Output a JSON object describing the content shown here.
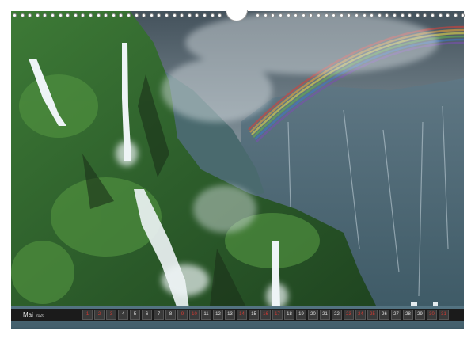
{
  "calendar": {
    "month": "Mai",
    "year": "2026",
    "days": [
      {
        "n": "1",
        "red": true
      },
      {
        "n": "2",
        "red": true
      },
      {
        "n": "3",
        "red": true
      },
      {
        "n": "4",
        "red": false
      },
      {
        "n": "5",
        "red": false
      },
      {
        "n": "6",
        "red": false
      },
      {
        "n": "7",
        "red": false
      },
      {
        "n": "8",
        "red": false
      },
      {
        "n": "9",
        "red": true
      },
      {
        "n": "10",
        "red": true
      },
      {
        "n": "11",
        "red": false
      },
      {
        "n": "12",
        "red": false
      },
      {
        "n": "13",
        "red": false
      },
      {
        "n": "14",
        "red": true
      },
      {
        "n": "15",
        "red": false
      },
      {
        "n": "16",
        "red": true
      },
      {
        "n": "17",
        "red": true
      },
      {
        "n": "18",
        "red": false
      },
      {
        "n": "19",
        "red": false
      },
      {
        "n": "20",
        "red": false
      },
      {
        "n": "21",
        "red": false
      },
      {
        "n": "22",
        "red": false
      },
      {
        "n": "23",
        "red": true
      },
      {
        "n": "24",
        "red": true
      },
      {
        "n": "25",
        "red": true
      },
      {
        "n": "26",
        "red": false
      },
      {
        "n": "27",
        "red": false
      },
      {
        "n": "28",
        "red": false
      },
      {
        "n": "29",
        "red": false
      },
      {
        "n": "30",
        "red": true
      },
      {
        "n": "31",
        "red": true
      }
    ],
    "weekend_color": "#d23a32"
  }
}
